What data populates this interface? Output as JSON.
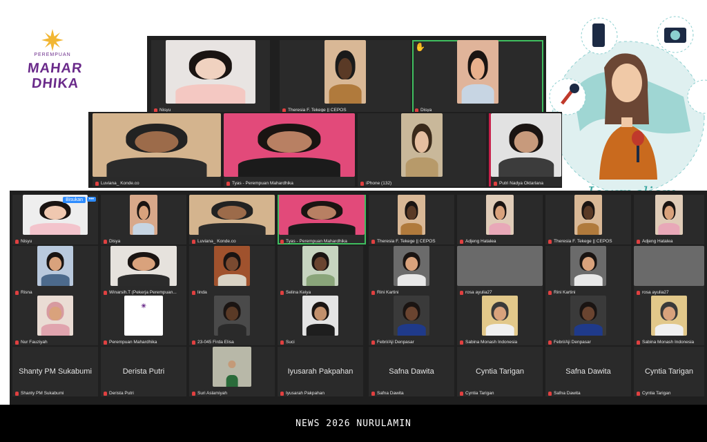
{
  "logo": {
    "top": "PEREMPUAN",
    "line1": "MAHAR",
    "line2": "DHIKA"
  },
  "journalism_label": "Journalism",
  "caption": "NEWS 2026 NURULAMIN",
  "colors": {
    "speaker": "#3fbf5f",
    "accent": "#2d8cff",
    "mic_off": "#e04040"
  },
  "tiles": {
    "t1": "Nisyu",
    "t2": "Theresia F. Tekege || CEPOS",
    "t3": "Disya",
    "t4": "Luviana_ Konde.co",
    "t5": "Tyas - Perempuan Mahardhika",
    "t6": "iPhone (132)",
    "t7": "Putri Nadya Oktarlana"
  },
  "grid": {
    "r1": [
      "Nisyu",
      "Disya",
      "Luviana_ Konde.co",
      "Tyas - Perempuan Mahardhika",
      "Theresia F. Tekege || CEPOS",
      "Adjeng Hatalea",
      "Theresia F. Tekege || CEPOS",
      "Adjeng Hatalea"
    ],
    "r2": [
      "Risna",
      "Winarsih.T (Pekerja Perempuan...",
      "linda",
      "Selina Keiya",
      "Rini Kartini",
      "rosa ayulia27",
      "Rini Kartini",
      "rosa ayulia27"
    ],
    "r3": [
      "Nur Fauziyah",
      "Perempuan Mahardhika",
      "23-045 Firda Elisa",
      "Suci",
      "Febri/Aji Denpasar",
      "Sabina Monash Indonesia",
      "Febri/Aji Denpasar",
      "Sabina Monash Indonesia"
    ],
    "r4": [
      "Shanty PM Sukabumi",
      "Derista Putri",
      "Suri Aslamiyah",
      "Iyusarah Pakpahan",
      "Safna Dawita",
      "Cyntia Tarigan",
      "Safna Dawita",
      "Cyntia Tarigan"
    ],
    "r4_big": [
      "Shanty PM Sukabumi",
      "Derista Putri",
      "",
      "Iyusarah Pakpahan",
      "Safna Dawita",
      "Cyntia Tarigan",
      "Safna Dawita",
      "Cyntia Tarigan"
    ]
  },
  "badges": {
    "bisukan": "Bisukan",
    "more": "•••"
  },
  "icons": {
    "hand": "raised-hand-icon",
    "mic": "mic-muted-icon"
  }
}
